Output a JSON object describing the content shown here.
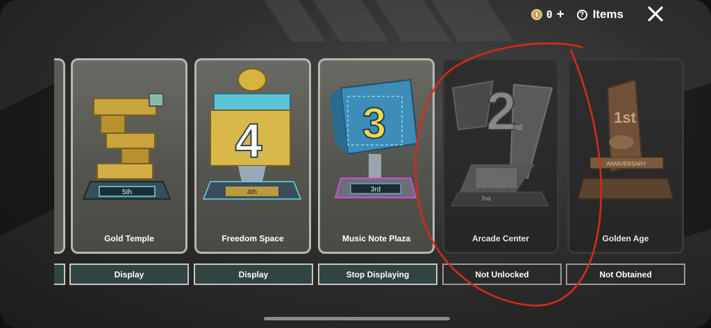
{
  "topbar": {
    "currency_value": "0",
    "currency_plus": "+",
    "items_label": "Items",
    "question_glyph": "?",
    "close_glyph": "✕"
  },
  "cards": [
    {
      "name": "Gold Temple",
      "rank_label": "5th",
      "button": "Display",
      "state": "unlocked"
    },
    {
      "name": "Freedom Space",
      "rank_label": "4th",
      "button": "Display",
      "state": "unlocked"
    },
    {
      "name": "Music Note Plaza",
      "rank_label": "3rd",
      "button": "Stop Displaying",
      "state": "displaying"
    },
    {
      "name": "Arcade Center",
      "rank_label": "2nd",
      "button": "Not Unlocked",
      "state": "locked"
    },
    {
      "name": "Golden Age",
      "rank_label": "1st",
      "button": "Not Obtained",
      "state": "locked"
    }
  ],
  "trophy_text": {
    "freedom_number": "4",
    "music_number": "3",
    "arcade_number": "2",
    "arcade_small": "nd",
    "golden_number": "1st",
    "golden_banner": "ANNIVERSARY"
  },
  "icons": {
    "currency": "coin-icon",
    "items": "question-circle-icon",
    "close": "close-icon"
  },
  "colors": {
    "button_teal": "#324344",
    "button_border": "#c8c8c0",
    "annotation_red": "#d62a1c"
  }
}
